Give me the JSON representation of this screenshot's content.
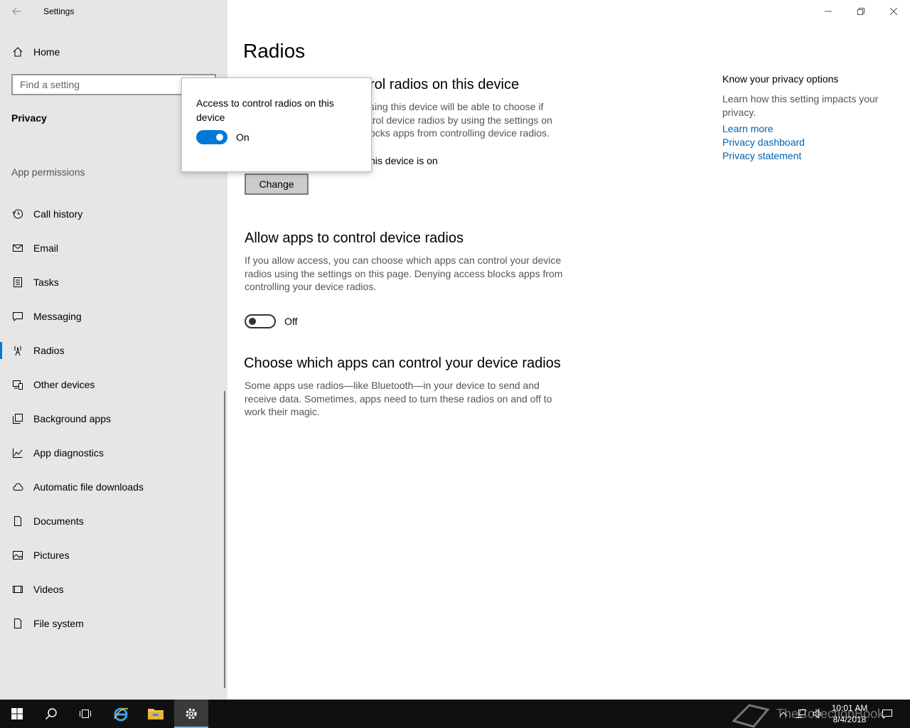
{
  "window": {
    "title": "Settings",
    "minimize_icon": "minimize-icon",
    "restore_icon": "restore-icon",
    "close_icon": "close-icon"
  },
  "sidebar": {
    "home_label": "Home",
    "search_placeholder": "Find a setting",
    "section_title": "Privacy",
    "group_label": "App permissions",
    "items": [
      {
        "label": "Call history",
        "icon": "history-icon"
      },
      {
        "label": "Email",
        "icon": "mail-icon"
      },
      {
        "label": "Tasks",
        "icon": "tasks-icon"
      },
      {
        "label": "Messaging",
        "icon": "message-icon"
      },
      {
        "label": "Radios",
        "icon": "radio-tower-icon",
        "selected": true
      },
      {
        "label": "Other devices",
        "icon": "devices-icon"
      },
      {
        "label": "Background apps",
        "icon": "background-apps-icon"
      },
      {
        "label": "App diagnostics",
        "icon": "diagnostics-icon"
      },
      {
        "label": "Automatic file downloads",
        "icon": "cloud-icon"
      },
      {
        "label": "Documents",
        "icon": "document-icon"
      },
      {
        "label": "Pictures",
        "icon": "picture-icon"
      },
      {
        "label": "Videos",
        "icon": "video-icon"
      },
      {
        "label": "File system",
        "icon": "file-icon"
      }
    ]
  },
  "main": {
    "page_title": "Radios",
    "section1": {
      "heading_visible": "rol radios on this device",
      "desc_visible": [
        "sing this device will be able to choose if",
        "trol device radios by using the settings on",
        "ocks apps from controlling device radios."
      ],
      "status_visible": "his device is on",
      "change_label": "Change"
    },
    "section2": {
      "heading": "Allow apps to control device radios",
      "desc": "If you allow access, you can choose which apps can control your device radios using the settings on this page. Denying access blocks apps from controlling your device radios.",
      "toggle_state": "Off"
    },
    "section3": {
      "heading": "Choose which apps can control your device radios",
      "desc": "Some apps use radios—like Bluetooth—in your device to send and receive data. Sometimes, apps need to turn these radios on and off to work their magic."
    }
  },
  "related": {
    "title": "Know your privacy options",
    "text": "Learn how this setting impacts your privacy.",
    "links": [
      "Learn more",
      "Privacy dashboard",
      "Privacy statement"
    ]
  },
  "flyout": {
    "title": "Access to control radios on this device",
    "toggle_state": "On"
  },
  "taskbar": {
    "time": "10:01 AM",
    "date": "8/4/2018",
    "watermark": "TheCollectionBook",
    "accent": "#0078d7"
  }
}
